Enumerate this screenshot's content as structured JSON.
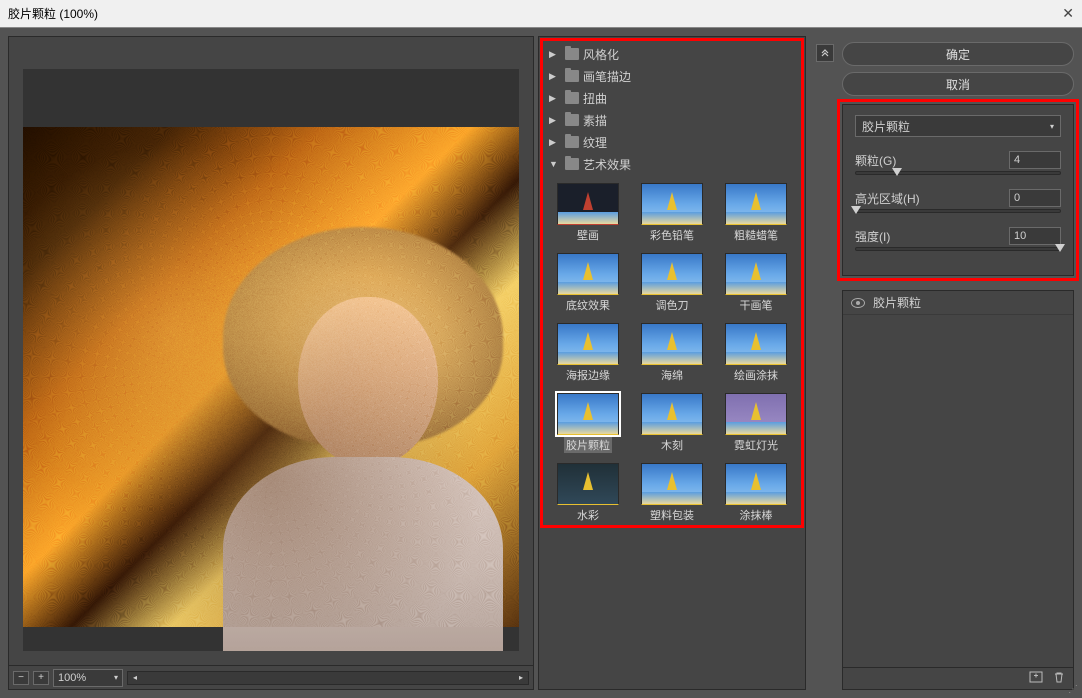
{
  "title": "胶片颗粒 (100%)",
  "preview": {
    "zoom": "100%",
    "fit_button": "⊡",
    "zoom_out": "−",
    "zoom_in": "+"
  },
  "categories": [
    {
      "label": "风格化",
      "open": false
    },
    {
      "label": "画笔描边",
      "open": false
    },
    {
      "label": "扭曲",
      "open": false
    },
    {
      "label": "素描",
      "open": false
    },
    {
      "label": "纹理",
      "open": false
    },
    {
      "label": "艺术效果",
      "open": true
    }
  ],
  "filters": [
    {
      "label": "壁画"
    },
    {
      "label": "彩色铅笔"
    },
    {
      "label": "粗糙蜡笔"
    },
    {
      "label": "底纹效果"
    },
    {
      "label": "调色刀"
    },
    {
      "label": "干画笔"
    },
    {
      "label": "海报边缘"
    },
    {
      "label": "海绵"
    },
    {
      "label": "绘画涂抹"
    },
    {
      "label": "胶片颗粒",
      "selected": true
    },
    {
      "label": "木刻"
    },
    {
      "label": "霓虹灯光"
    },
    {
      "label": "水彩"
    },
    {
      "label": "塑料包装"
    },
    {
      "label": "涂抹棒"
    }
  ],
  "buttons": {
    "ok": "确定",
    "cancel": "取消"
  },
  "panel": {
    "filter_name": "胶片颗粒",
    "params": [
      {
        "label": "颗粒(G)",
        "value": "4",
        "pos": 20
      },
      {
        "label": "高光区域(H)",
        "value": "0",
        "pos": 0
      },
      {
        "label": "强度(I)",
        "value": "10",
        "pos": 100
      }
    ]
  },
  "layers": {
    "row_label": "胶片颗粒"
  }
}
